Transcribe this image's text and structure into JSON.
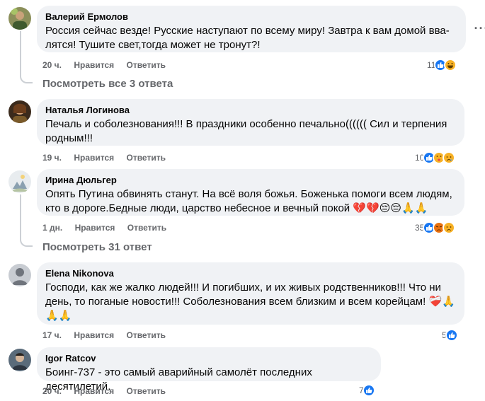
{
  "comments": [
    {
      "author": "Валерий Ермолов",
      "text": "Россия сейчас везде! Русские наступают по всему миру! Завтра к вам домой вва­лятся! Тушите свет,тогда может не тронут?!",
      "time": "20 ч.",
      "like": "Нравится",
      "reply": "Ответить",
      "reaction_count": "11",
      "reactions": [
        "like-icon",
        "haha-icon"
      ],
      "view_replies": "Посмотреть все 3 ответа"
    },
    {
      "author": "Наталья Логинова",
      "text": "Печаль и соболезнования!!! В праздники особенно печально(((((( Сил и терпения родным!!!",
      "time": "19 ч.",
      "like": "Нравится",
      "reply": "Ответить",
      "reaction_count": "10",
      "reactions": [
        "like-icon",
        "care-icon",
        "sad-icon"
      ]
    },
    {
      "author": "Ирина Дюльгер",
      "text": "Опять Путина обвинять станут. На всё воля божья. Боженька помоги всем людям, кто в дороге.Бедные люди, царство небесное и вечный покой 💔💔😔😔🙏🙏",
      "time": "1 дн.",
      "like": "Нравится",
      "reply": "Ответить",
      "reaction_count": "35",
      "reactions": [
        "like-icon",
        "angry-icon",
        "sad-icon"
      ],
      "view_replies": "Посмотреть 31 ответ"
    },
    {
      "author": "Elena Nikonova",
      "text": "Господи, как же жалко людей!!! И погибших, и их живых родственников!!! Что ни день, то поганые новости!!! Соболезнования всем близким и всем корейцам! ❤️‍🩹🙏 🙏🙏",
      "time": "17 ч.",
      "like": "Нравится",
      "reply": "Ответить",
      "reaction_count": "5",
      "reactions": [
        "like-icon"
      ]
    },
    {
      "author": "Igor Ratcov",
      "text": "Боинг-737 - это самый аварийный самолёт последних десятилетий.",
      "time": "20 ч.",
      "like": "Нравится",
      "reply": "Ответить",
      "reaction_count": "7",
      "reactions": [
        "like-icon"
      ]
    }
  ],
  "colors": {
    "bubble": "#f0f2f5",
    "meta": "#65676b",
    "like_blue": "#1877f2",
    "sad_yellow": "#f7b125",
    "angry_red": "#e9710f"
  }
}
